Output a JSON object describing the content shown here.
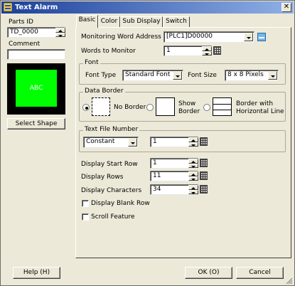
{
  "window": {
    "title": "Text Alarm",
    "close_label": "✕"
  },
  "left": {
    "parts_id_label": "Parts ID",
    "parts_id_value": "TD_0000",
    "comment_label": "Comment",
    "comment_value": "",
    "preview_text": "ABC",
    "preview_color": "#00ff00",
    "select_shape_label": "Select Shape"
  },
  "tabs": [
    {
      "label": "Basic",
      "active": true
    },
    {
      "label": "Color",
      "active": false
    },
    {
      "label": "Sub Display",
      "active": false
    },
    {
      "label": "Switch",
      "active": false
    }
  ],
  "basic": {
    "monitor_address_label": "Monitoring Word Address",
    "monitor_address_value": "[PLC1]D00000",
    "words_to_monitor_label": "Words to Monitor",
    "words_to_monitor_value": "1",
    "font_group_label": "Font",
    "font_type_label": "Font Type",
    "font_type_value": "Standard Font",
    "font_size_label": "Font Size",
    "font_size_value": "8 x 8 Pixels",
    "data_border_label": "Data Border",
    "border_options": [
      {
        "label": "No Border",
        "checked": true
      },
      {
        "label": "Show\nBorder",
        "checked": false
      },
      {
        "label": "Border with\nHorizontal Line",
        "checked": false
      }
    ],
    "text_file_number_label": "Text File Number",
    "text_file_mode_value": "Constant",
    "text_file_number_value": "1",
    "display_start_row_label": "Display Start Row",
    "display_start_row_value": "1",
    "display_rows_label": "Display Rows",
    "display_rows_value": "11",
    "display_chars_label": "Display Characters",
    "display_chars_value": "34",
    "display_blank_row_label": "Display Blank Row",
    "display_blank_row_checked": false,
    "scroll_feature_label": "Scroll Feature",
    "scroll_feature_checked": false
  },
  "footer": {
    "help_label": "Help (H)",
    "ok_label": "OK (O)",
    "cancel_label": "Cancel"
  }
}
